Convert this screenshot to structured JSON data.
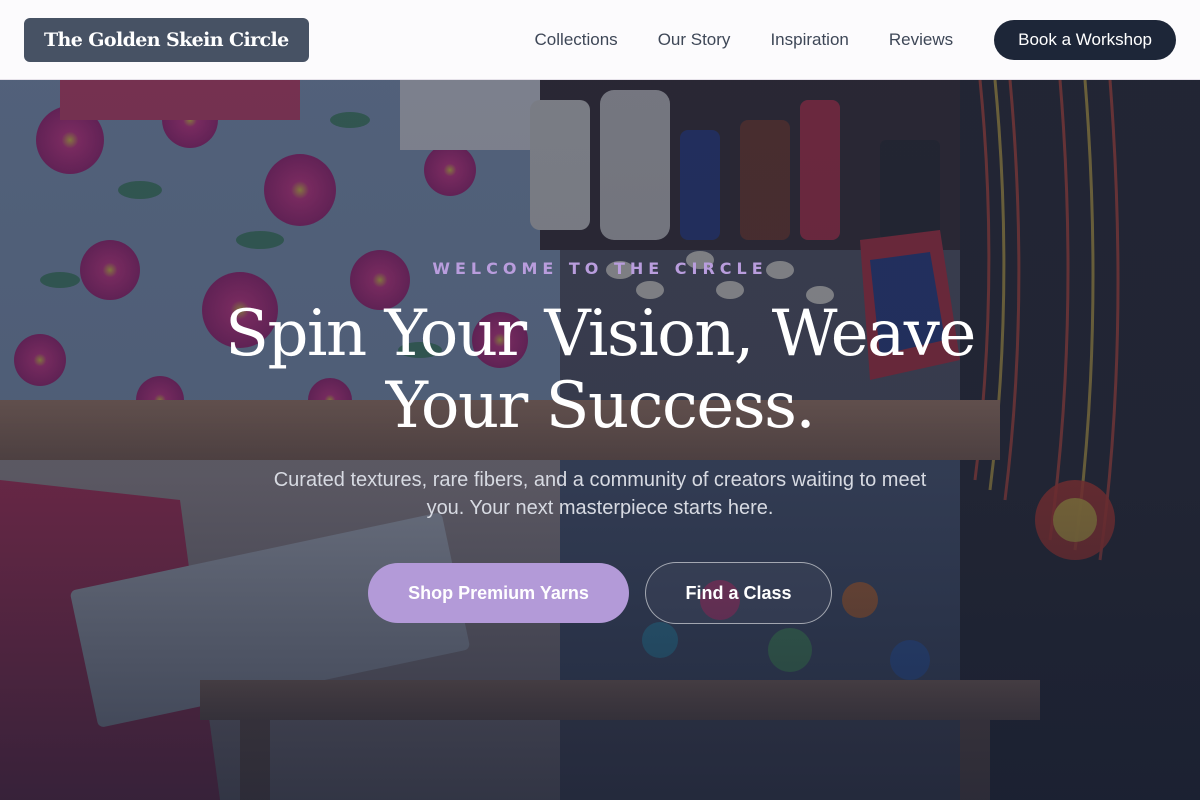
{
  "brand": {
    "name": "The Golden Skein Circle"
  },
  "nav": {
    "links": [
      "Collections",
      "Our Story",
      "Inspiration",
      "Reviews"
    ],
    "cta_label": "Book a Workshop"
  },
  "hero": {
    "eyebrow": "WELCOME TO THE CIRCLE",
    "headline": "Spin Your Vision, Weave Your Success.",
    "subtext": "Curated textures, rare fibers, and a community of creators waiting to meet you. Your next masterpiece starts here.",
    "primary_button": "Shop Premium Yarns",
    "secondary_button": "Find a Class",
    "background_image": "market stall with floral fabrics, bottles and beaded necklaces"
  },
  "colors": {
    "nav_bg": "#fcfbfd",
    "logo_bg": "#475264",
    "nav_cta_bg": "#1d2638",
    "eyebrow": "#b99ddd",
    "primary_button": "#b39ad8",
    "overlay": "#1a2134"
  }
}
